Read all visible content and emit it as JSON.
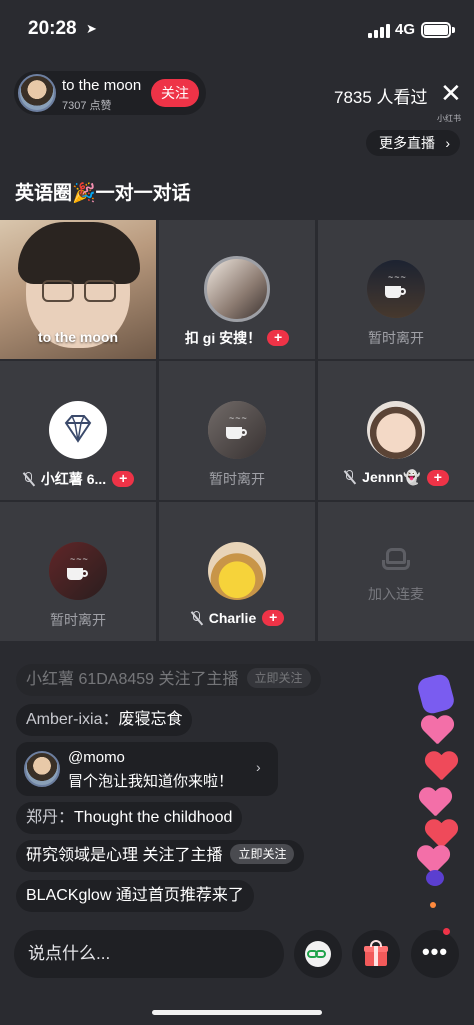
{
  "status_bar": {
    "time": "20:28",
    "network": "4G"
  },
  "host": {
    "name": "to the moon",
    "likes": "7307 点赞",
    "follow_label": "关注"
  },
  "header": {
    "viewers": "7835 人看过",
    "brand_mark": "小红书",
    "more_live_label": "更多直播"
  },
  "room": {
    "title": "英语圈🎉一对一对话"
  },
  "seats": [
    {
      "label": "to the moon"
    },
    {
      "label": "扣 gi 安搜！"
    },
    {
      "label": "暂时离开"
    },
    {
      "label": "小红薯 6..."
    },
    {
      "label": "暂时离开"
    },
    {
      "label": "Jennn👻"
    },
    {
      "label": "暂时离开"
    },
    {
      "label": "Charlie"
    },
    {
      "label": "加入连麦"
    }
  ],
  "chat": {
    "messages": [
      {
        "text": "小红薯 61DA8459 关注了主播",
        "chip": "立即关注"
      },
      {
        "name": "Amber-ixia：",
        "text": "废寝忘食"
      },
      {
        "title": "@momo",
        "text": "冒个泡让我知道你来啦！"
      },
      {
        "name": "郑丹：",
        "text": "Thought the childhood"
      },
      {
        "text": "研究领域是心理 关注了主播",
        "chip": "立即关注"
      },
      {
        "text": "BLACKglow 通过首页推荐来了"
      }
    ]
  },
  "input": {
    "placeholder": "说点什么..."
  },
  "buttons": {
    "more_dots": "•••"
  }
}
